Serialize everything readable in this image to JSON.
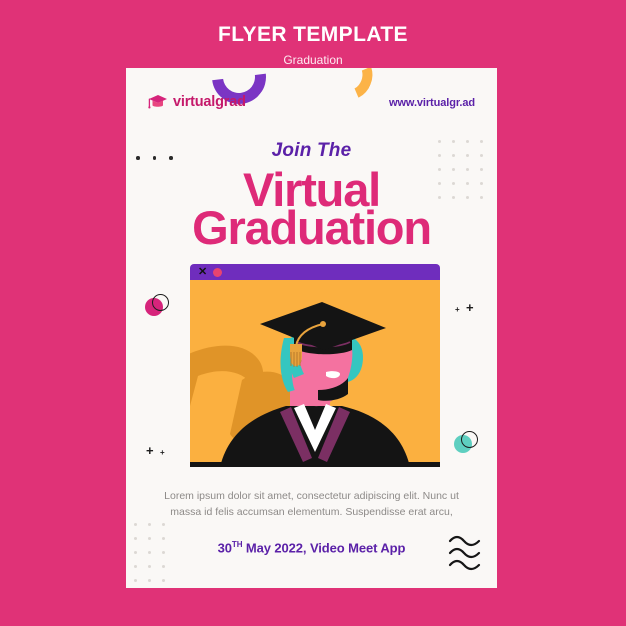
{
  "header": {
    "title": "FLYER TEMPLATE",
    "subtitle": "Graduation"
  },
  "flyer": {
    "logo": {
      "icon": "graduation-cap-icon",
      "text": "virtualgrad",
      "color": "#c51a6b"
    },
    "website": "www.virtualgr.ad",
    "headline": {
      "kicker": "Join The",
      "line1": "Virtual",
      "line2": "Graduation",
      "kicker_color": "#5b21a8",
      "headline_color": "#de2a78"
    },
    "video_window": {
      "close_label": "✕",
      "record_dot": "record-indicator",
      "bar_color": "#6f2dbd",
      "screen_color": "#fbb040"
    },
    "illustration": {
      "name": "graduate-portrait",
      "skin_color": "#f472a0",
      "hair_color": "#35c6c0",
      "cap_color": "#141414",
      "tassel_color": "#e8a33d",
      "gown_color": "#141414",
      "stole_color": "#7b2f63",
      "shirt_color": "#ffffff",
      "background_color": "#fbb040",
      "leaf_color": "#e09428"
    },
    "body_copy": "Lorem ipsum dolor sit amet, consectetur adipiscing elit. Nunc ut massa id felis accumsan elementum. Suspendisse erat arcu,",
    "date_line": {
      "day": "30",
      "ordinal": "TH",
      "rest": " May 2022, Video Meet App",
      "color": "#5b21a8"
    }
  },
  "theme": {
    "page_background": "#e03277",
    "card_background": "#faf8f6",
    "dot_grid_color": "#dcd8d4",
    "accent_purple": "#7b35c4",
    "accent_orange": "#fcb347",
    "accent_pink": "#d6247b",
    "accent_teal": "#5ecfc0"
  }
}
